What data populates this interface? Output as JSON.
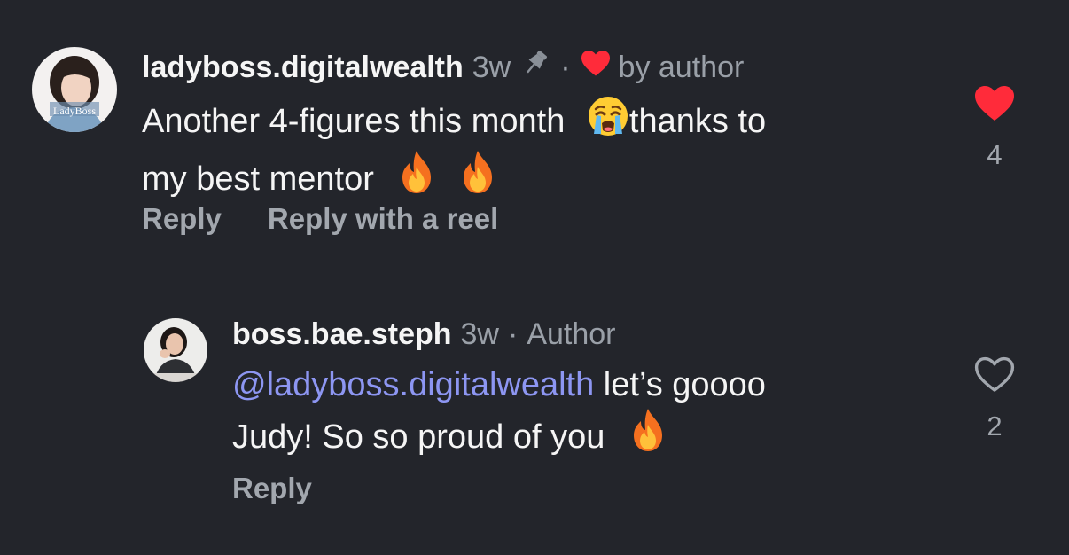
{
  "comments": [
    {
      "username": "ladyboss.digitalwealth",
      "time": "3w",
      "separator": "·",
      "badge": "by author",
      "avatar_text": "LadyBoss",
      "text_line1_a": "Another 4-figures this month",
      "text_line1_b": "thanks to",
      "text_line2": "my best mentor",
      "actions": {
        "reply": "Reply",
        "reply_reel": "Reply with a reel"
      },
      "likes": "4",
      "liked": true
    },
    {
      "username": "boss.bae.steph",
      "time": "3w",
      "separator": "·",
      "badge": "Author",
      "mention": "@ladyboss.digitalwealth",
      "text_line1": " let’s goooo",
      "text_line2": "Judy! So so proud of you",
      "actions": {
        "reply": "Reply"
      },
      "likes": "2",
      "liked": false
    }
  ],
  "colors": {
    "background": "#23252b",
    "liked_heart": "#ff2b3a",
    "mention": "#8d96f2",
    "muted": "#9aa0a8"
  }
}
